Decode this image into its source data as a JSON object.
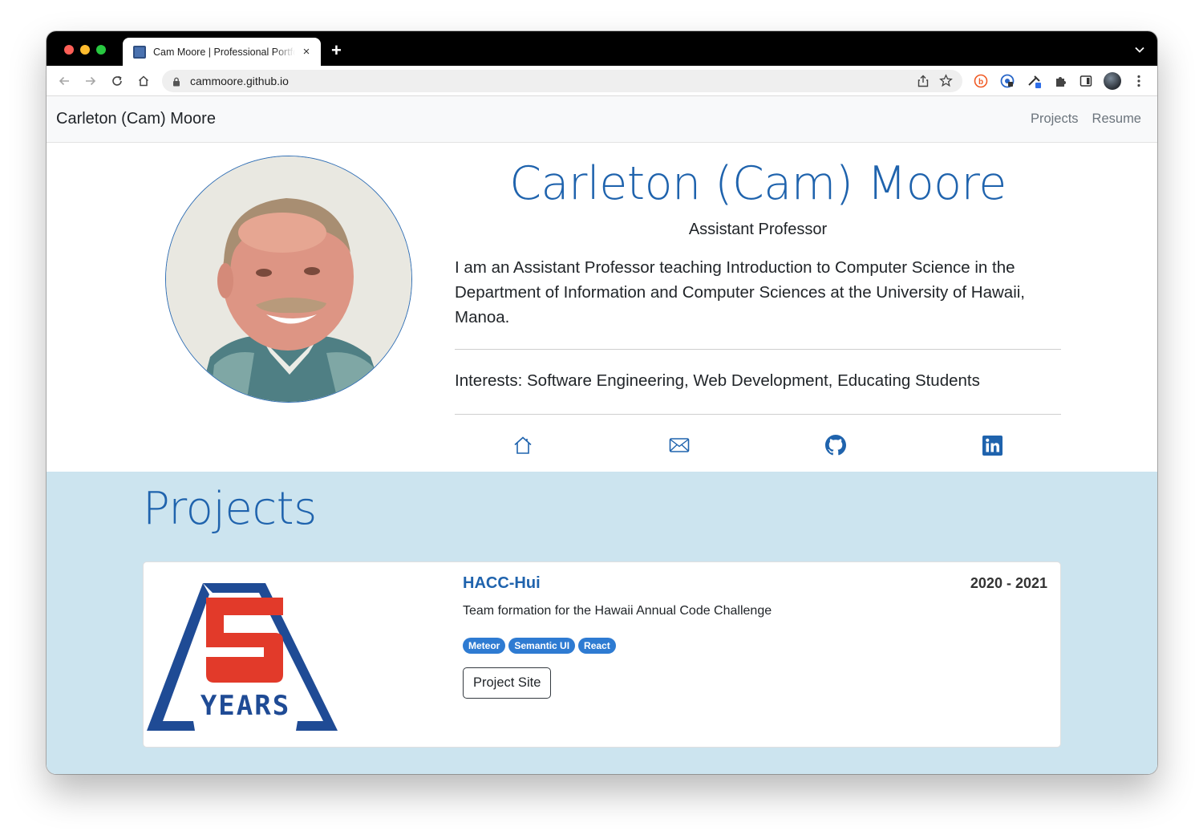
{
  "browser": {
    "tab_title": "Cam Moore | Professional Portfolio",
    "tab_close": "×",
    "new_tab": "+",
    "url": "cammoore.github.io"
  },
  "site": {
    "brand": "Carleton (Cam) Moore",
    "nav": [
      "Projects",
      "Resume"
    ]
  },
  "hero": {
    "name": "Carleton (Cam) Moore",
    "title": "Assistant Professor",
    "bio": "I am an Assistant Professor teaching Introduction to Computer Science in the Department of Information and Computer Sciences at the University of Hawaii, Manoa.",
    "interests": "Interests: Software Engineering, Web Development, Educating Students",
    "social_icons": [
      "home-icon",
      "envelope-icon",
      "github-icon",
      "linkedin-icon"
    ]
  },
  "projects": {
    "heading": "Projects",
    "items": [
      {
        "title": "HACC-Hui",
        "years": "2020 - 2021",
        "description": "Team formation for the Hawaii Annual Code Challenge",
        "tags": [
          "Meteor",
          "Semantic UI",
          "React"
        ],
        "button": "Project Site",
        "logo_text": "YEARS"
      }
    ]
  },
  "colors": {
    "accent": "#1f63ad",
    "projects_bg": "#cce4ef",
    "tag_bg": "#2e7bd2",
    "logo_red": "#e23a2a",
    "logo_blue": "#1f4b95"
  }
}
